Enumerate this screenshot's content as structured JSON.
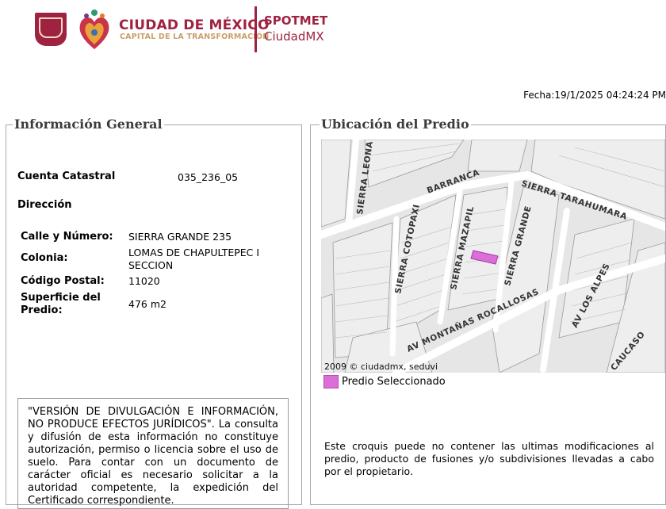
{
  "header": {
    "brand_title": "CIUDAD DE MÉXICO",
    "brand_subtitle": "CAPITAL DE LA TRANSFORMACIÓN",
    "app_title": "SPOTMET",
    "app_subtitle": "CiudadMX",
    "fecha": "Fecha:19/1/2025 04:24:24 PM"
  },
  "general": {
    "legend": "Información General",
    "cuenta_label": "Cuenta Catastral",
    "cuenta_value": "035_236_05",
    "direccion_label": "Dirección",
    "calle_label": "Calle y Número:",
    "calle_value": "SIERRA GRANDE 235",
    "colonia_label": "Colonia:",
    "colonia_value": "LOMAS DE CHAPULTEPEC I SECCION",
    "cp_label": "Código Postal:",
    "cp_value": "11020",
    "superficie_label": "Superficie del Predio:",
    "superficie_value": "476 m2",
    "notice": "\"VERSIÓN DE DIVULGACIÓN E INFORMACIÓN, NO PRODUCE EFECTOS JURÍDICOS\". La consulta y difusión de esta información no constituye autorización, permiso o licencia sobre el uso de suelo. Para contar con un documento de carácter oficial es necesario solicitar a la autoridad competente, la expedición del Certificado correspondiente."
  },
  "ubicacion": {
    "legend": "Ubicación del Predio",
    "streets": [
      "SIERRA LEONA",
      "BARRANCA",
      "SIERRA TARAHUMARA",
      "SIERRA COTOPAXI",
      "SIERRA MAZAPIL",
      "SIERRA GRANDE",
      "AV MONTAÑAS ROCALLOSAS",
      "AV LOS ALPES",
      "CAUCASO"
    ],
    "copyright": "2009 © ciudadmx, seduvi",
    "legend_item": "Predio Seleccionado",
    "legend_color": "#da6fd8",
    "croquis_note": "Este croquis puede no contener las ultimas modificaciones al predio, producto de fusiones y/o subdivisiones llevadas a cabo por el propietario."
  }
}
